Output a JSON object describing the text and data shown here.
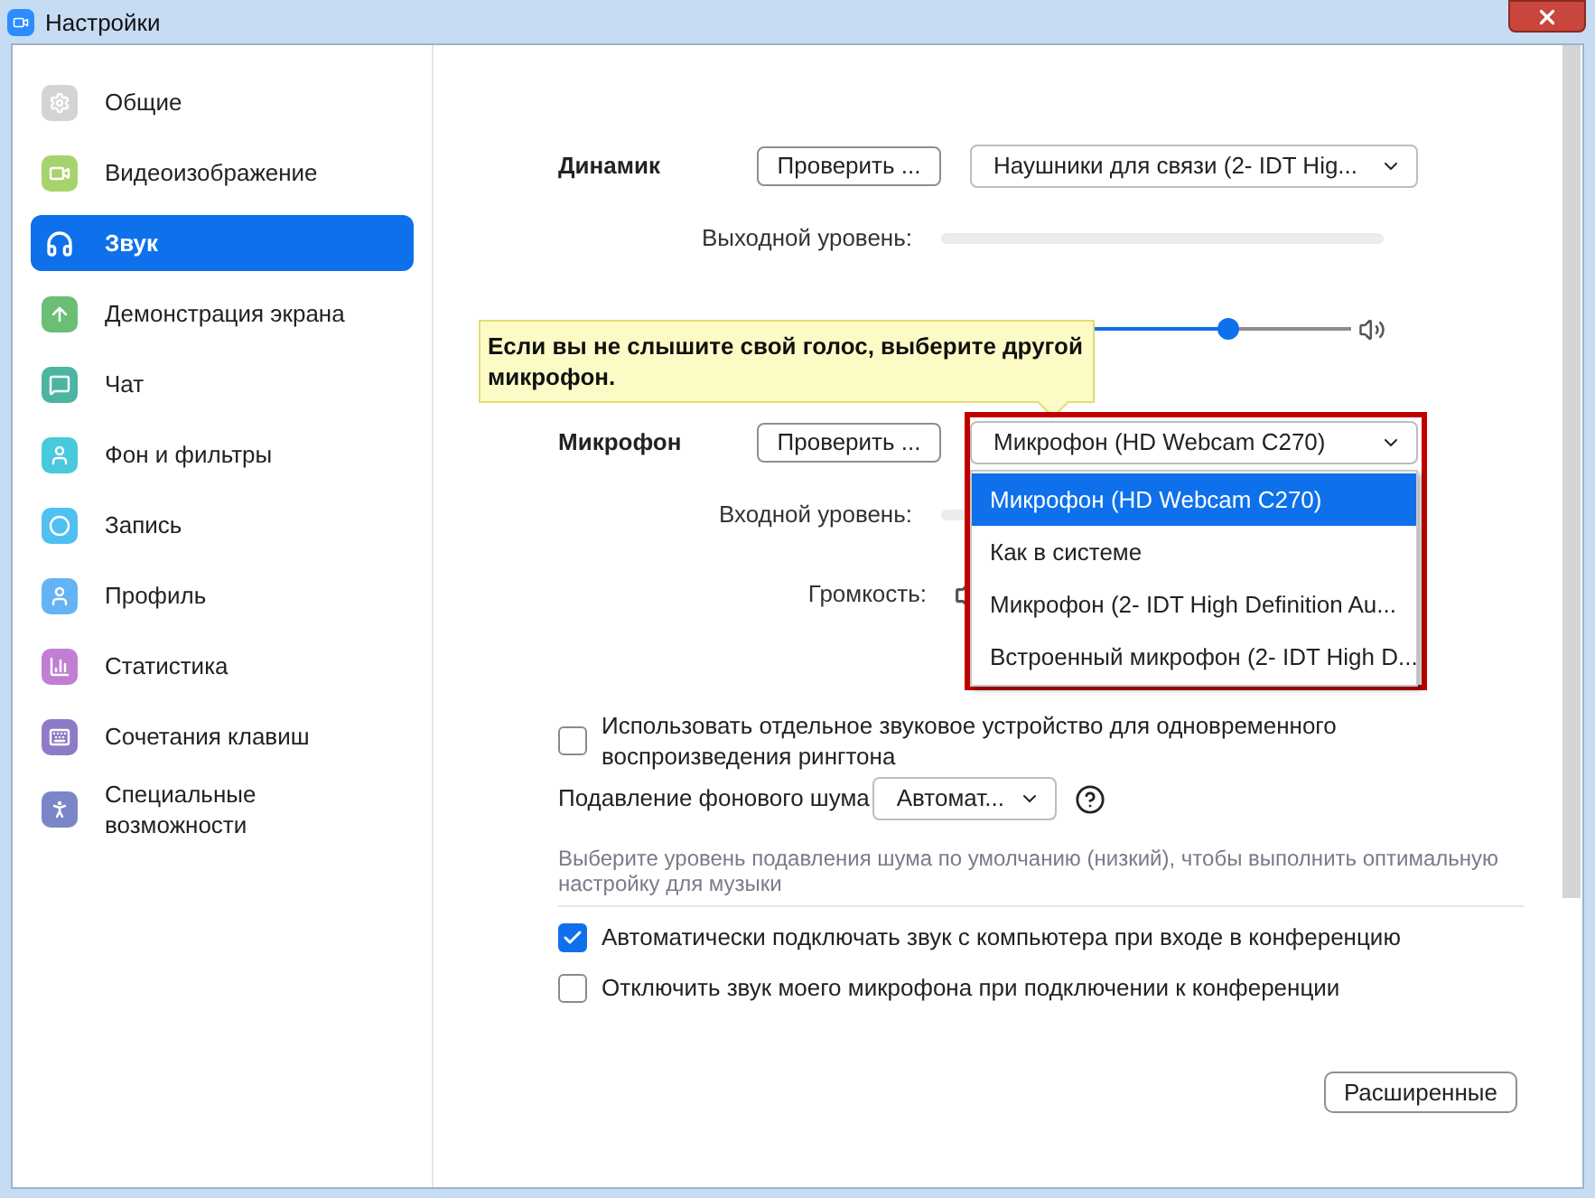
{
  "window": {
    "title": "Настройки"
  },
  "sidebar": {
    "items": [
      {
        "label": "Общие",
        "selected": false,
        "color": "#d4d4d4"
      },
      {
        "label": "Видеоизображение",
        "selected": false,
        "color": "#a6d36d"
      },
      {
        "label": "Звук",
        "selected": true
      },
      {
        "label": "Демонстрация экрана",
        "selected": false,
        "color": "#6abf74"
      },
      {
        "label": "Чат",
        "selected": false,
        "color": "#4cb5a2"
      },
      {
        "label": "Фон и фильтры",
        "selected": false,
        "color": "#48c9dc"
      },
      {
        "label": "Запись",
        "selected": false,
        "color": "#4fc0f2"
      },
      {
        "label": "Профиль",
        "selected": false,
        "color": "#63b3f5"
      },
      {
        "label": "Статистика",
        "selected": false,
        "color": "#c17ed3"
      },
      {
        "label": "Сочетания клавиш",
        "selected": false,
        "color": "#8e7bc8"
      },
      {
        "label": "Специальные возможности",
        "selected": false,
        "color": "#7b86c9"
      }
    ]
  },
  "speaker": {
    "label": "Динамик",
    "test_button": "Проверить ...",
    "device": "Наушники для связи (2- IDT Hig...",
    "output_label": "Выходной уровень:",
    "output_meter": {
      "level": 0
    },
    "volume_slider": {
      "level": 0.7
    }
  },
  "tooltip": "Если вы не слышите свой голос, выберите другой микрофон.",
  "microphone": {
    "label": "Микрофон",
    "test_button": "Проверить ...",
    "device": "Микрофон (HD Webcam C270)",
    "input_label": "Входной уровень:",
    "volume_label": "Громкость:",
    "options": [
      {
        "label": "Микрофон (HD Webcam C270)",
        "selected": true
      },
      {
        "label": "Как в системе",
        "selected": false
      },
      {
        "label": "Микрофон (2- IDT High Definition Au...",
        "selected": false
      },
      {
        "label": "Встроенный микрофон (2- IDT High D...",
        "selected": false
      }
    ]
  },
  "ringtone_option": {
    "label": "Использовать отдельное звуковое устройство для одновременного воспроизведения рингтона",
    "checked": false
  },
  "noise_suppression": {
    "label": "Подавление фонового шума",
    "value": "Автомат...",
    "hint": "Выберите уровень подавления шума по умолчанию (низкий), чтобы выполнить оптимальную настройку для музыки"
  },
  "options": [
    {
      "label": "Автоматически подключать звук с компьютера при входе в конференцию",
      "checked": true
    },
    {
      "label": "Отключить звук моего микрофона при подключении к конференции",
      "checked": false
    }
  ],
  "advanced_button": "Расширенные"
}
